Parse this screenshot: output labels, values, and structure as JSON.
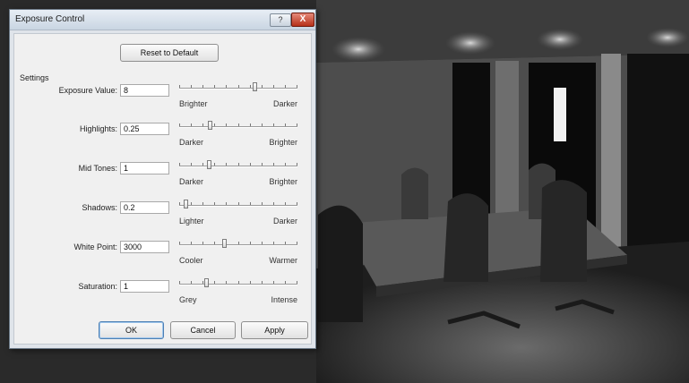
{
  "dialog": {
    "title": "Exposure Control",
    "help_glyph": "?",
    "close_glyph": "X",
    "reset_label": "Reset to Default",
    "settings_label": "Settings",
    "rows": [
      {
        "label": "Exposure Value:",
        "value": "8",
        "left": "Brighter",
        "right": "Darker",
        "slider": 0.64
      },
      {
        "label": "Highlights:",
        "value": "0.25",
        "left": "Darker",
        "right": "Brighter",
        "slider": 0.26
      },
      {
        "label": "Mid Tones:",
        "value": "1",
        "left": "Darker",
        "right": "Brighter",
        "slider": 0.25
      },
      {
        "label": "Shadows:",
        "value": "0.2",
        "left": "Lighter",
        "right": "Darker",
        "slider": 0.05
      },
      {
        "label": "White Point:",
        "value": "3000",
        "left": "Cooler",
        "right": "Warmer",
        "slider": 0.38
      },
      {
        "label": "Saturation:",
        "value": "1",
        "left": "Grey",
        "right": "Intense",
        "slider": 0.23
      }
    ],
    "ok_label": "OK",
    "cancel_label": "Cancel",
    "apply_label": "Apply"
  },
  "colors": {
    "title_gradient_top": "#e8eef5",
    "close_button": "#c8432b",
    "dialog_face": "#f0f0f0"
  }
}
